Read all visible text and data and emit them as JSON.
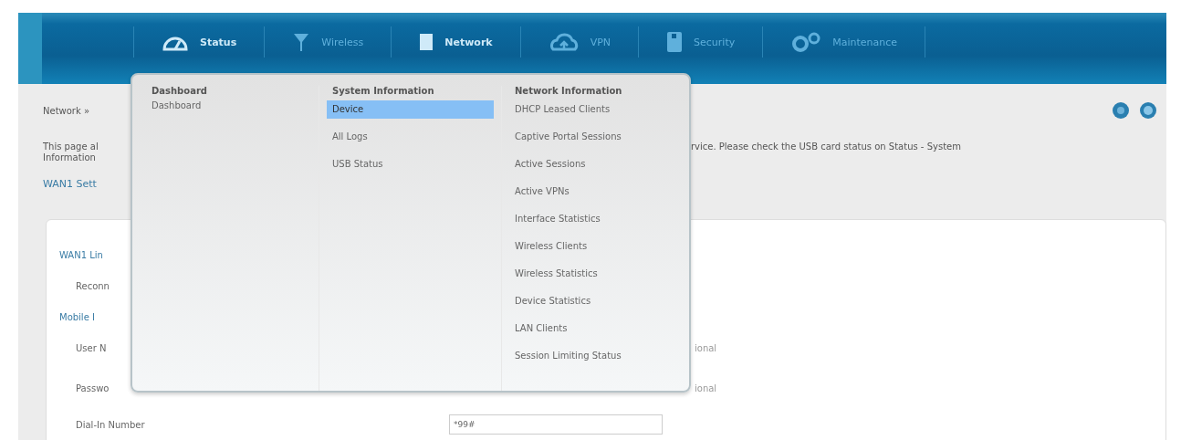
{
  "nav_tabs": [
    {
      "label": "Status",
      "highlighted": true
    },
    {
      "label": "Wireless",
      "highlighted": false
    },
    {
      "label": "Network",
      "highlighted": true
    },
    {
      "label": "VPN",
      "highlighted": false
    },
    {
      "label": "Security",
      "highlighted": false
    },
    {
      "label": "Maintenance",
      "highlighted": false
    }
  ],
  "dropdown_menu": {
    "columns": [
      {
        "heading": "Dashboard",
        "items": [
          {
            "label": "Dashboard",
            "selected": false
          }
        ]
      },
      {
        "heading": "System Information",
        "items": [
          {
            "label": "Device",
            "selected": true
          },
          {
            "label": "All Logs",
            "selected": false
          },
          {
            "label": "USB Status",
            "selected": false
          }
        ]
      },
      {
        "heading": "Network Information",
        "items": [
          {
            "label": "DHCP Leased Clients",
            "selected": false
          },
          {
            "label": "Captive Portal Sessions",
            "selected": false
          },
          {
            "label": "Active Sessions",
            "selected": false
          },
          {
            "label": "Active VPNs",
            "selected": false
          },
          {
            "label": "Interface Statistics",
            "selected": false
          },
          {
            "label": "Wireless Clients",
            "selected": false
          },
          {
            "label": "Wireless Statistics",
            "selected": false
          },
          {
            "label": "Device Statistics",
            "selected": false
          },
          {
            "label": "LAN Clients",
            "selected": false
          },
          {
            "label": "Session Limiting Status",
            "selected": false
          }
        ]
      }
    ]
  },
  "breadcrumb": "Network »",
  "description": {
    "left_lines": [
      "This page al",
      "Information"
    ],
    "right_text": "rvice. Please check the USB card status on Status - System"
  },
  "section_title": "WAN1 Sett",
  "card": {
    "rows": [
      {
        "kind": "heading",
        "label": "WAN1 Lin"
      },
      {
        "kind": "field",
        "label": "Reconn"
      },
      {
        "kind": "heading",
        "label": "Mobile I"
      },
      {
        "kind": "field",
        "label": "User N",
        "hint": "ional"
      },
      {
        "kind": "field",
        "label": "Passwo",
        "hint": "ional"
      },
      {
        "kind": "input",
        "label": "Dial-In Number",
        "value": "*99#"
      }
    ]
  }
}
